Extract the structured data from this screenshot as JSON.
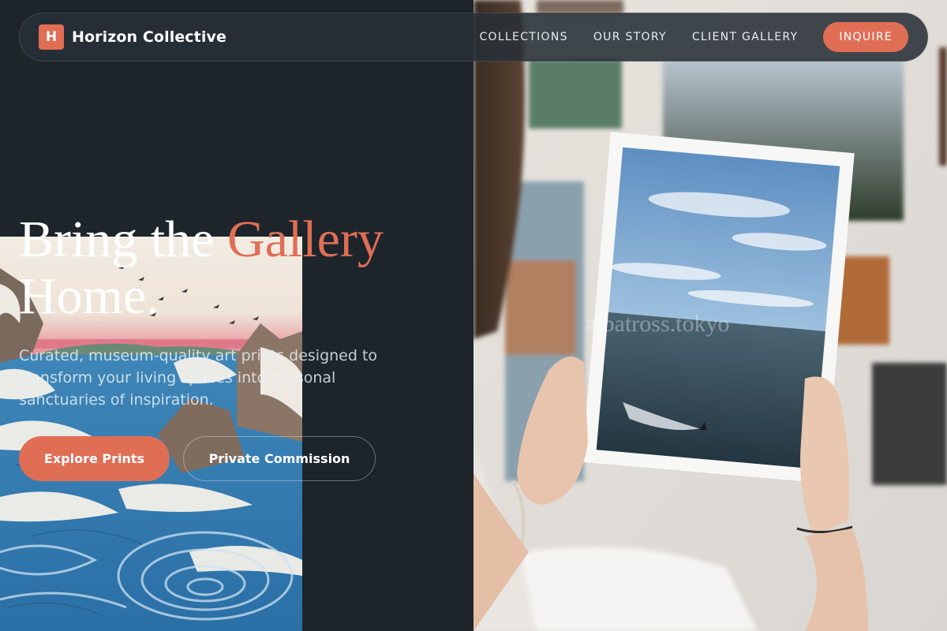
{
  "brand": {
    "mark": "H",
    "name": "Horizon Collective"
  },
  "nav": {
    "links": [
      "COLLECTIONS",
      "OUR STORY",
      "CLIENT GALLERY"
    ],
    "cta": "INQUIRE"
  },
  "hero": {
    "title_pre": "Bring the ",
    "title_accent": "Gallery",
    "title_post": "Home.",
    "subtitle": "Curated, museum-quality art prints designed to transform your living spaces into personal sanctuaries of inspiration.",
    "primary_button": "Explore Prints",
    "secondary_button": "Private Commission"
  },
  "images": {
    "wave_print": "japanese-wave-woodblock-print",
    "hero_photo": "woman-holding-ocean-print-photo",
    "photo_watermark": "albatross.tokyo"
  },
  "colors": {
    "background": "#1d252b",
    "accent": "#e06e55",
    "nav_bg": "#283037"
  }
}
